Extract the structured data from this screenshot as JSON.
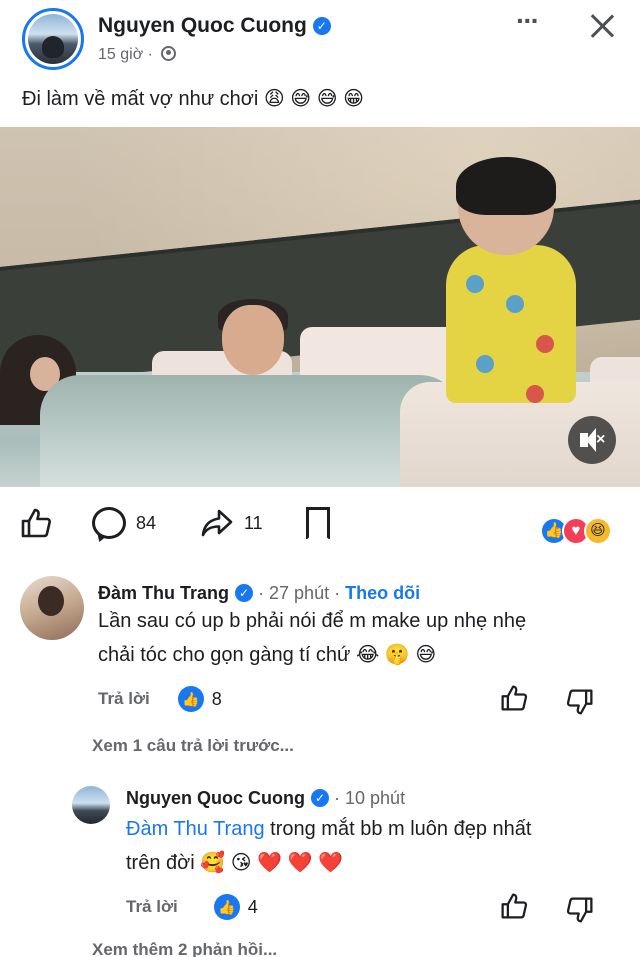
{
  "post": {
    "author": "Nguyen Quoc Cuong",
    "time": "15 giờ",
    "dot": "·",
    "caption": "Đi làm về mất vợ như chơi 😩 😅 😅 😁",
    "more": "···"
  },
  "actions": {
    "comments": "84",
    "shares": "11",
    "reactions": [
      "like",
      "love",
      "haha"
    ]
  },
  "comment1": {
    "author": "Đàm Thu Trang",
    "time": "· 27 phút ·",
    "follow": "Theo dõi",
    "line1": "Lần sau có up b phải nói để m make up nhẹ nhẹ",
    "line2": "chải tóc cho gọn gàng tí chứ 😂 🤫 😅",
    "reply": "Trả lời",
    "likes": "8"
  },
  "view_prev": "Xem 1 câu trả lời trước...",
  "reply1": {
    "author": "Nguyen Quoc Cuong",
    "time": "· 10 phút",
    "mention": "Đàm Thu Trang",
    "line1_rest": " trong mắt bb m luôn đẹp nhất",
    "line2": "trên đời 🥰 😘 ❤️ ❤️ ❤️",
    "reply": "Trả lời",
    "likes": "4"
  },
  "view_more": "Xem thêm 2 phản hồi..."
}
